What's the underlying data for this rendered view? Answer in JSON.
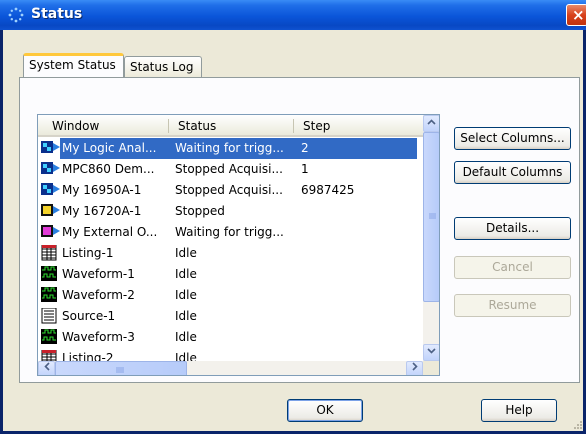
{
  "window": {
    "title": "Status",
    "close_label": "×"
  },
  "tabs": [
    {
      "label": "System Status",
      "active": true
    },
    {
      "label": "Status Log",
      "active": false
    }
  ],
  "list": {
    "columns": [
      "Window",
      "Status",
      "Step"
    ],
    "rows": [
      {
        "icon": "logic-analyzer-icon",
        "window": "My Logic Anal...",
        "status": "Waiting for trigg...",
        "step": "2",
        "selected": true
      },
      {
        "icon": "logic-analyzer-icon",
        "window": "MPC860 Dem...",
        "status": "Stopped Acquisi...",
        "step": "1",
        "selected": false
      },
      {
        "icon": "logic-analyzer-icon",
        "window": "My 16950A-1",
        "status": "Stopped Acquisi...",
        "step": "6987425",
        "selected": false
      },
      {
        "icon": "module-yellow-icon",
        "window": "My 16720A-1",
        "status": "Stopped",
        "step": "",
        "selected": false
      },
      {
        "icon": "module-magenta-icon",
        "window": "My External O...",
        "status": "Waiting for trigg...",
        "step": "",
        "selected": false
      },
      {
        "icon": "listing-icon",
        "window": "Listing-1",
        "status": "Idle",
        "step": "",
        "selected": false
      },
      {
        "icon": "waveform-icon",
        "window": "Waveform-1",
        "status": "Idle",
        "step": "",
        "selected": false
      },
      {
        "icon": "waveform-icon",
        "window": "Waveform-2",
        "status": "Idle",
        "step": "",
        "selected": false
      },
      {
        "icon": "source-icon",
        "window": "Source-1",
        "status": "Idle",
        "step": "",
        "selected": false
      },
      {
        "icon": "waveform-icon",
        "window": "Waveform-3",
        "status": "Idle",
        "step": "",
        "selected": false
      },
      {
        "icon": "listing-icon",
        "window": "Listing-2",
        "status": "Idle",
        "step": "",
        "selected": false
      }
    ]
  },
  "side_buttons": {
    "select_columns": "Select Columns...",
    "default_columns": "Default Columns",
    "details": "Details...",
    "cancel": "Cancel",
    "resume": "Resume"
  },
  "footer": {
    "ok": "OK",
    "help": "Help"
  },
  "colors": {
    "title_bar": "#0a55d9",
    "selection": "#316ac5",
    "dialog_bg": "#ece9d8",
    "active_tab_accent": "#ffc83c"
  }
}
